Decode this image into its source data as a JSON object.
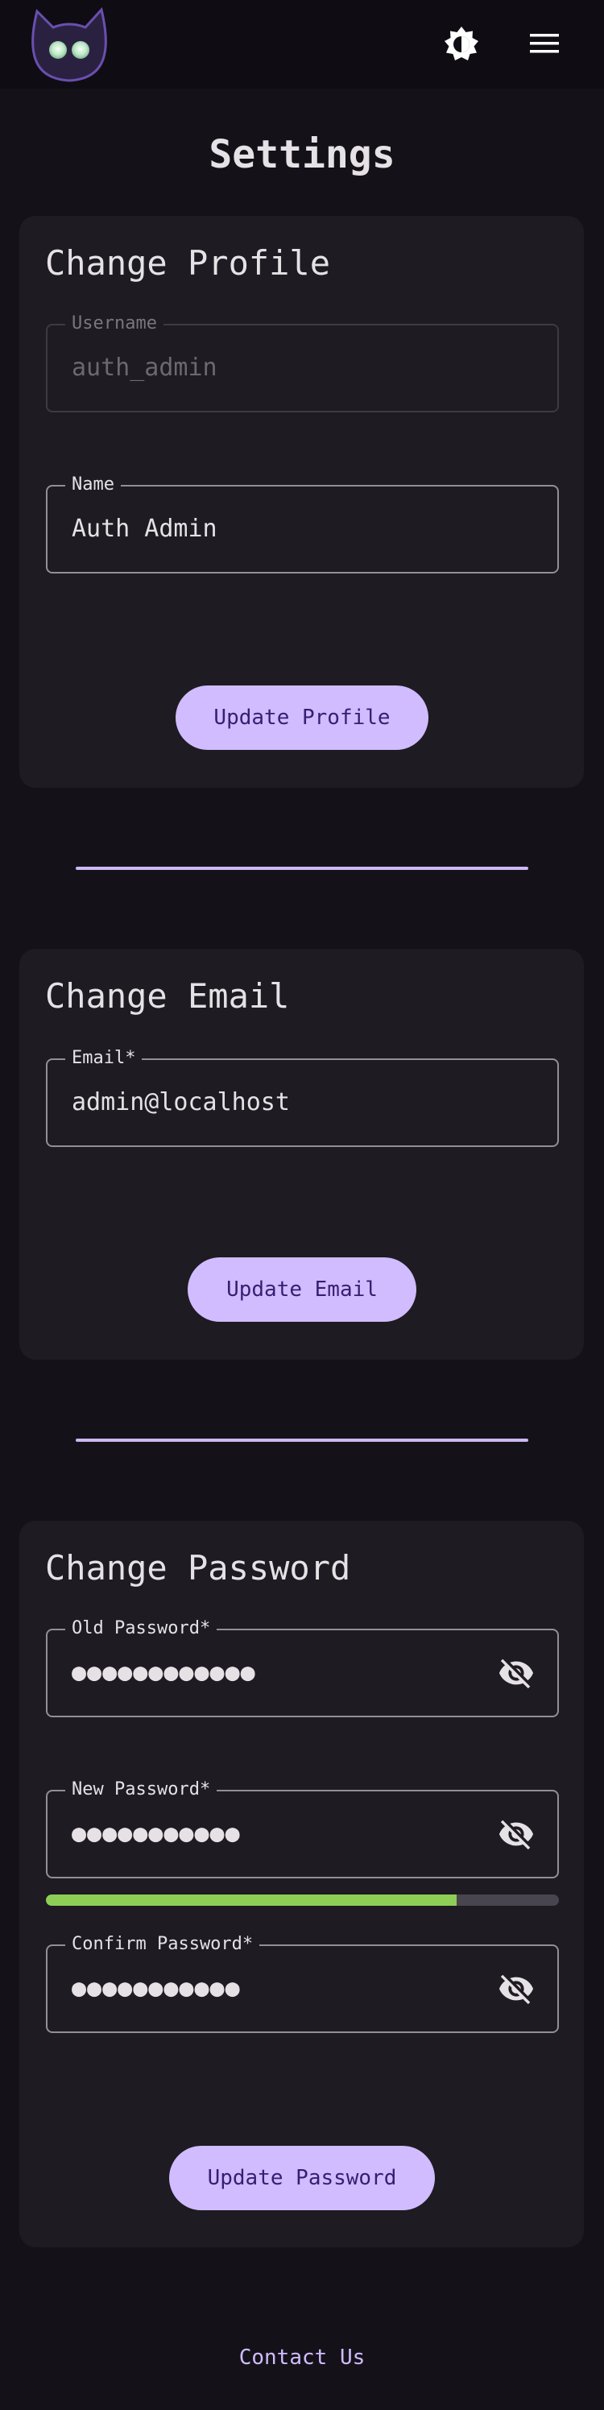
{
  "header": {
    "logo_icon": "cat-logo-icon",
    "theme_icon": "theme-toggle-icon",
    "menu_icon": "hamburger-menu-icon"
  },
  "page": {
    "title": "Settings"
  },
  "profile": {
    "title": "Change Profile",
    "username_label": "Username",
    "username_value": "auth_admin",
    "name_label": "Name",
    "name_value": "Auth Admin",
    "button": "Update Profile"
  },
  "email": {
    "title": "Change Email",
    "email_label": "Email*",
    "email_value": "admin@localhost",
    "button": "Update Email"
  },
  "password": {
    "title": "Change Password",
    "old_label": "Old Password*",
    "old_value": "●●●●●●●●●●●●",
    "new_label": "New Password*",
    "new_value": "●●●●●●●●●●●",
    "strength": 0.8,
    "strength_color": "#8fce56",
    "confirm_label": "Confirm Password*",
    "confirm_value": "●●●●●●●●●●●",
    "button": "Update Password",
    "visibility_icon": "eye-off-icon"
  },
  "footer": {
    "contact": "Contact Us"
  },
  "colors": {
    "background": "#141218",
    "card": "#1e1b22",
    "accent": "#d0bcff",
    "accent_text": "#381e72"
  }
}
